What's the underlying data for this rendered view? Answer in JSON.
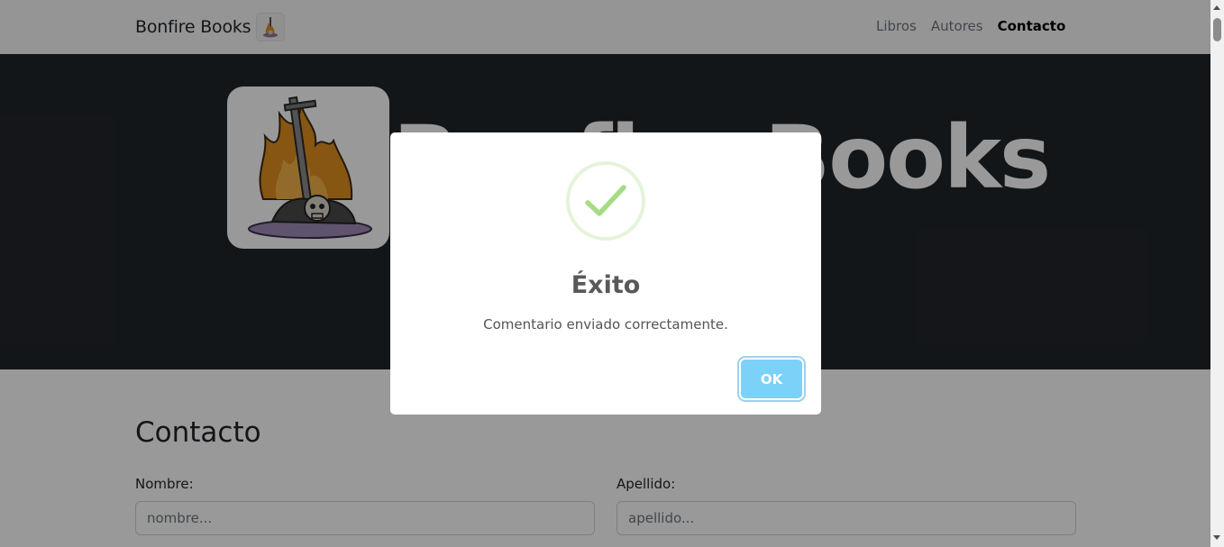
{
  "navbar": {
    "brand": "Bonfire Books",
    "links": [
      "Libros",
      "Autores",
      "Contacto"
    ],
    "active": "Contacto"
  },
  "hero": {
    "title": "Bonfire Books"
  },
  "contact": {
    "title": "Contacto",
    "first_name_label": "Nombre:",
    "first_name_placeholder": "nombre...",
    "last_name_label": "Apellido:",
    "last_name_placeholder": "apellido..."
  },
  "modal": {
    "icon": "success-check-icon",
    "title": "Éxito",
    "text": "Comentario enviado correctamente.",
    "confirm_label": "OK"
  },
  "colors": {
    "navbar_bg": "#f8f9fa",
    "hero_bg": "#212529",
    "success_green": "#a5dc86",
    "confirm_button": "#7cd1f9"
  }
}
